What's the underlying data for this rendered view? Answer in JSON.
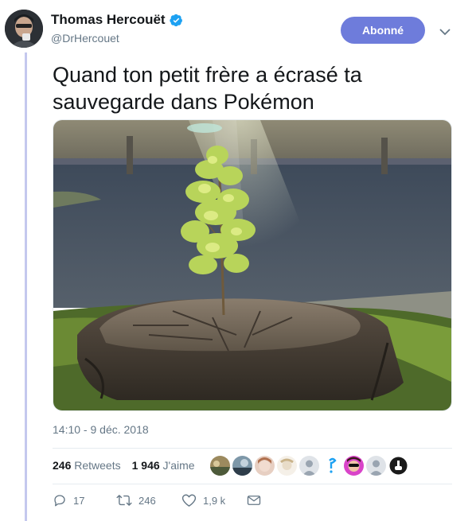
{
  "user": {
    "display_name": "Thomas Hercouët",
    "handle": "@DrHercouet",
    "verified": true
  },
  "follow_button": {
    "label": "Abonné",
    "color": "#6e7cdb"
  },
  "tweet": {
    "text": "Quand ton petit frère a écrasé ta sauvegarde dans Pokémon",
    "media_description_icon": "tree-stump-photo",
    "timestamp": "14:10 - 9 déc. 2018"
  },
  "stats": {
    "retweets_count": "246",
    "retweets_label": "Retweets",
    "likes_count": "1 946",
    "likes_label": "J'aime",
    "liker_avatar_count": 9
  },
  "actions": {
    "replies": "17",
    "retweets": "246",
    "likes": "1,9 k"
  },
  "colors": {
    "accent": "#6e7cdb",
    "text_primary": "#14171a",
    "text_secondary": "#657786",
    "verified": "#1da1f2",
    "thread_line": "#c4c8ee"
  }
}
